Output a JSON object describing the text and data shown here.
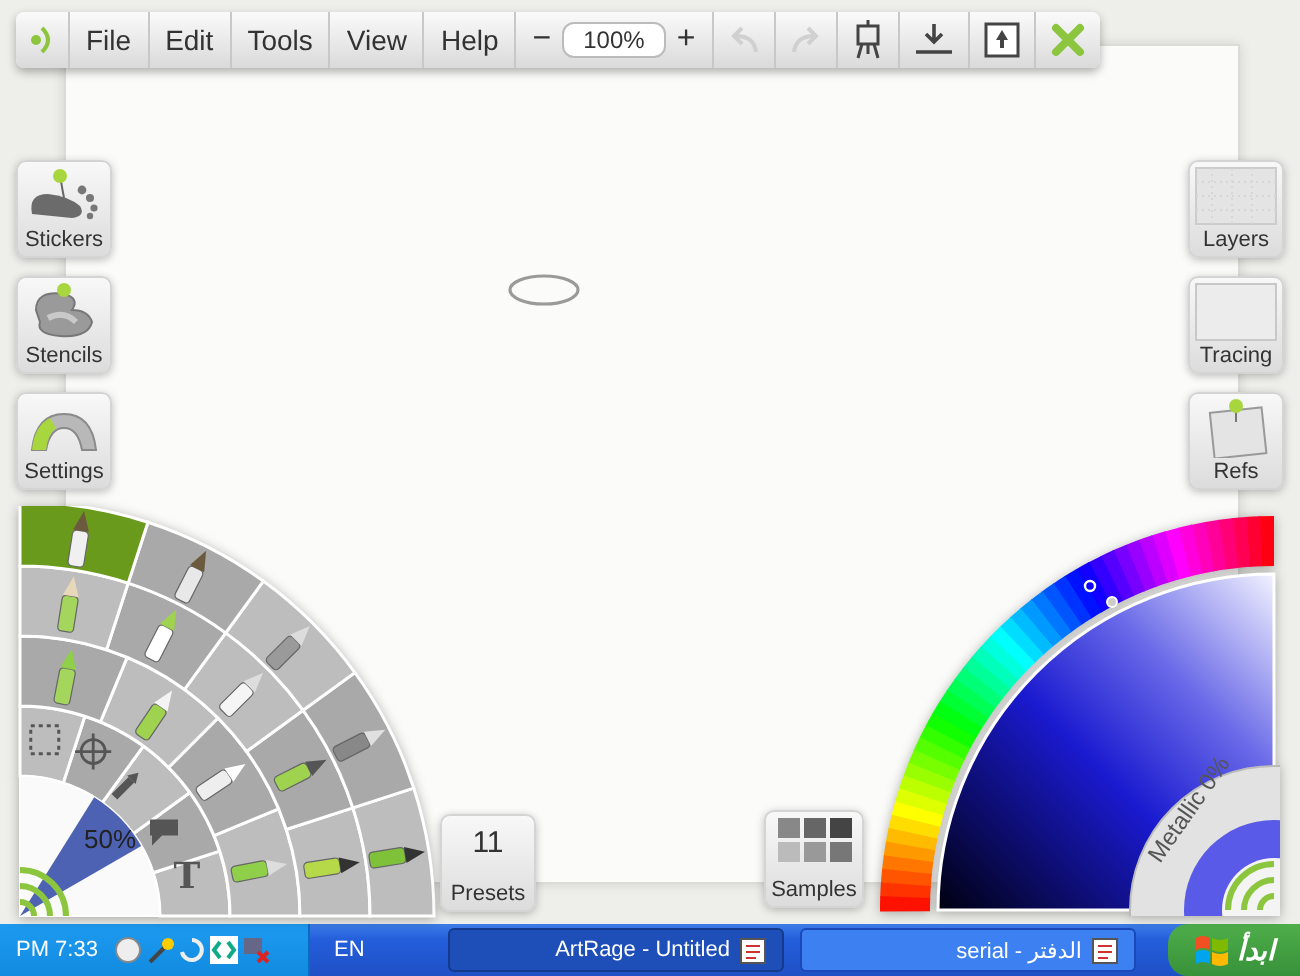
{
  "toolbar": {
    "menus": [
      "File",
      "Edit",
      "Tools",
      "View",
      "Help"
    ],
    "zoom": {
      "minus": "−",
      "value": "100%",
      "plus": "+"
    },
    "undo": {
      "disabled": true
    },
    "redo": {
      "disabled": true
    }
  },
  "left_panels": [
    {
      "kind": "stickers",
      "label": "Stickers"
    },
    {
      "kind": "stencils",
      "label": "Stencils"
    },
    {
      "kind": "settings",
      "label": "Settings"
    }
  ],
  "right_panels": [
    {
      "kind": "layers",
      "label": "Layers"
    },
    {
      "kind": "tracing",
      "label": "Tracing"
    },
    {
      "kind": "refs",
      "label": "Refs"
    }
  ],
  "tool_wheel": {
    "brush_size": "50%",
    "text_tool": "T"
  },
  "presets": {
    "count": "11",
    "label": "Presets"
  },
  "samples": {
    "label": "Samples"
  },
  "color_picker": {
    "metallic": "Metallic 0%"
  },
  "taskbar": {
    "clock": "PM 7:33",
    "language": "EN",
    "tasks": [
      {
        "label": "ArtRage - Untitled",
        "selected": true
      },
      {
        "label": "serial - الدفتر",
        "selected": false
      }
    ],
    "start": "ابدأ"
  }
}
